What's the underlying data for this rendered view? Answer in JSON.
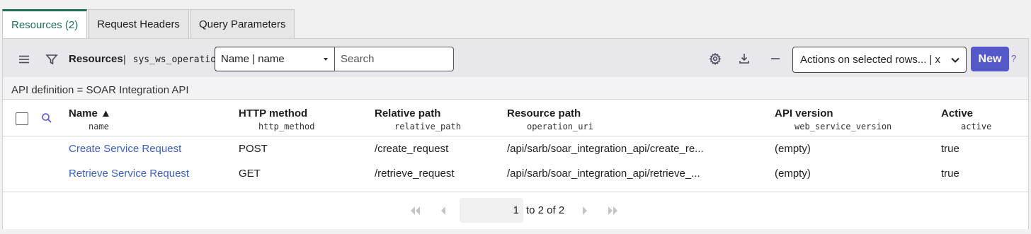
{
  "tabs": [
    {
      "label": "Resources (2)",
      "active": true
    },
    {
      "label": "Request Headers",
      "active": false
    },
    {
      "label": "Query Parameters",
      "active": false
    }
  ],
  "toolbar": {
    "title": "Resources",
    "table_name": "| sys_ws_operation",
    "field_select": "Name | name",
    "search_placeholder": "Search",
    "actions_label": "Actions on selected rows...",
    "actions_suffix": "| x",
    "new_label": "New",
    "help": "?"
  },
  "filter": "API definition = SOAR Integration API",
  "columns": [
    {
      "label": "Name ▲",
      "field": "name"
    },
    {
      "label": "HTTP method",
      "field": "http_method"
    },
    {
      "label": "Relative path",
      "field": "relative_path"
    },
    {
      "label": "Resource path",
      "field": "operation_uri"
    },
    {
      "label": "API version",
      "field": "web_service_version"
    },
    {
      "label": "Active",
      "field": "active"
    }
  ],
  "rows": [
    {
      "name": "Create Service Request",
      "http_method": "POST",
      "relative_path": "/create_request",
      "resource_path": "/api/sarb/soar_integration_api/create_re...",
      "api_version": "(empty)",
      "active": "true"
    },
    {
      "name": "Retrieve Service Request",
      "http_method": "GET",
      "relative_path": "/retrieve_request",
      "resource_path": "/api/sarb/soar_integration_api/retrieve_...",
      "api_version": "(empty)",
      "active": "true"
    }
  ],
  "pager": {
    "current": "1",
    "range_text": "to 2 of 2"
  },
  "colors": {
    "accent_green": "#1f6f53",
    "primary": "#5558c8",
    "link": "#3a60c8"
  }
}
